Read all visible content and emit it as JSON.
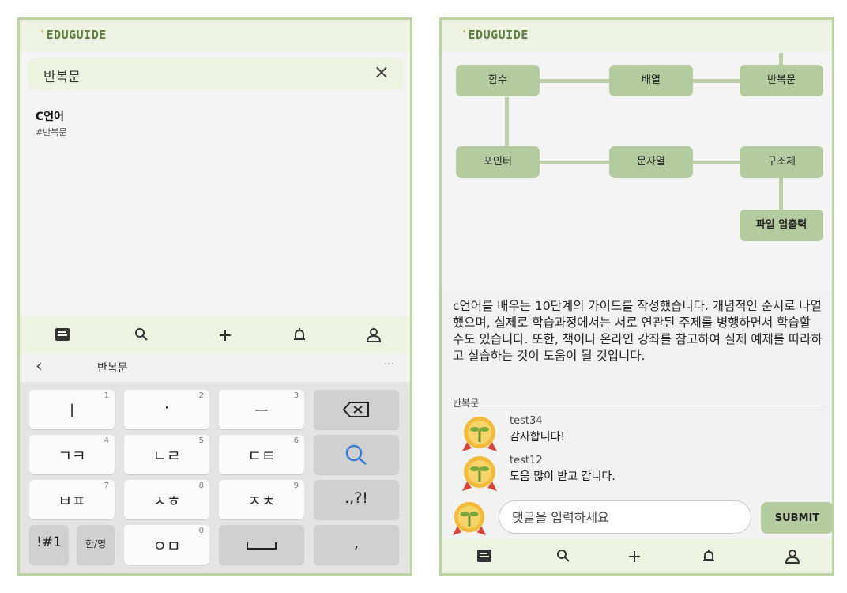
{
  "app": {
    "logo": "EDUGUIDE"
  },
  "search_screen": {
    "query": "반복문",
    "clear_icon": "close-icon",
    "result": {
      "title": "C언어",
      "tag": "#반복문"
    },
    "keyboard_bar": {
      "back_icon": "chevron-left-icon",
      "preview": "반복문",
      "more": "···"
    },
    "keyboard": {
      "keys": [
        {
          "label": "ㅣ",
          "num": "1"
        },
        {
          "label": "·",
          "num": "2"
        },
        {
          "label": "ㅡ",
          "num": "3"
        },
        {
          "label": "backspace-icon",
          "num": ""
        },
        {
          "label": "ㄱㅋ",
          "num": "4"
        },
        {
          "label": "ㄴㄹ",
          "num": "5"
        },
        {
          "label": "ㄷㅌ",
          "num": "6"
        },
        {
          "label": "search-icon",
          "num": ""
        },
        {
          "label": "ㅂㅍ",
          "num": "7"
        },
        {
          "label": "ㅅㅎ",
          "num": "8"
        },
        {
          "label": "ㅈㅊ",
          "num": "9"
        },
        {
          "label": ".,?!",
          "num": ""
        },
        {
          "label": "!#1",
          "num": ""
        },
        {
          "label": "한/영",
          "num": ""
        },
        {
          "label": "ㅇㅁ",
          "num": "0"
        },
        {
          "label": "space-icon",
          "num": ""
        },
        {
          "label": ",",
          "num": ""
        }
      ]
    }
  },
  "detail_screen": {
    "nodes": {
      "function": "함수",
      "array": "배열",
      "loop": "반복문",
      "pointer": "포인터",
      "string": "문자열",
      "struct": "구조체",
      "file_io": "파일 입출력"
    },
    "description": "c언어를 배우는 10단계의 가이드를 작성했습니다. 개념적인 순서로 나열했으며, 실제로 학습과정에서는 서로 연관된 주제를 병행하면서 학습할 수도 있습니다. 또한, 책이나 온라인 강좌를 참고하여 실제 예제를 따라하고 실습하는 것이 도움이 될 것입니다.",
    "tag": "반복문",
    "comments": [
      {
        "user": "test34",
        "text": "감사합니다!"
      },
      {
        "user": "test12",
        "text": "도움 많이 받고 갑니다."
      }
    ],
    "comment_placeholder": "댓글을 입력하세요",
    "submit_label": "SUBMIT"
  },
  "bottom_nav": [
    "document-icon",
    "search-icon",
    "plus-icon",
    "bell-icon",
    "user-icon"
  ],
  "colors": {
    "accent": "#b4cb9f",
    "header_bg": "#eef2e2",
    "frame": "#bcd3a3"
  }
}
